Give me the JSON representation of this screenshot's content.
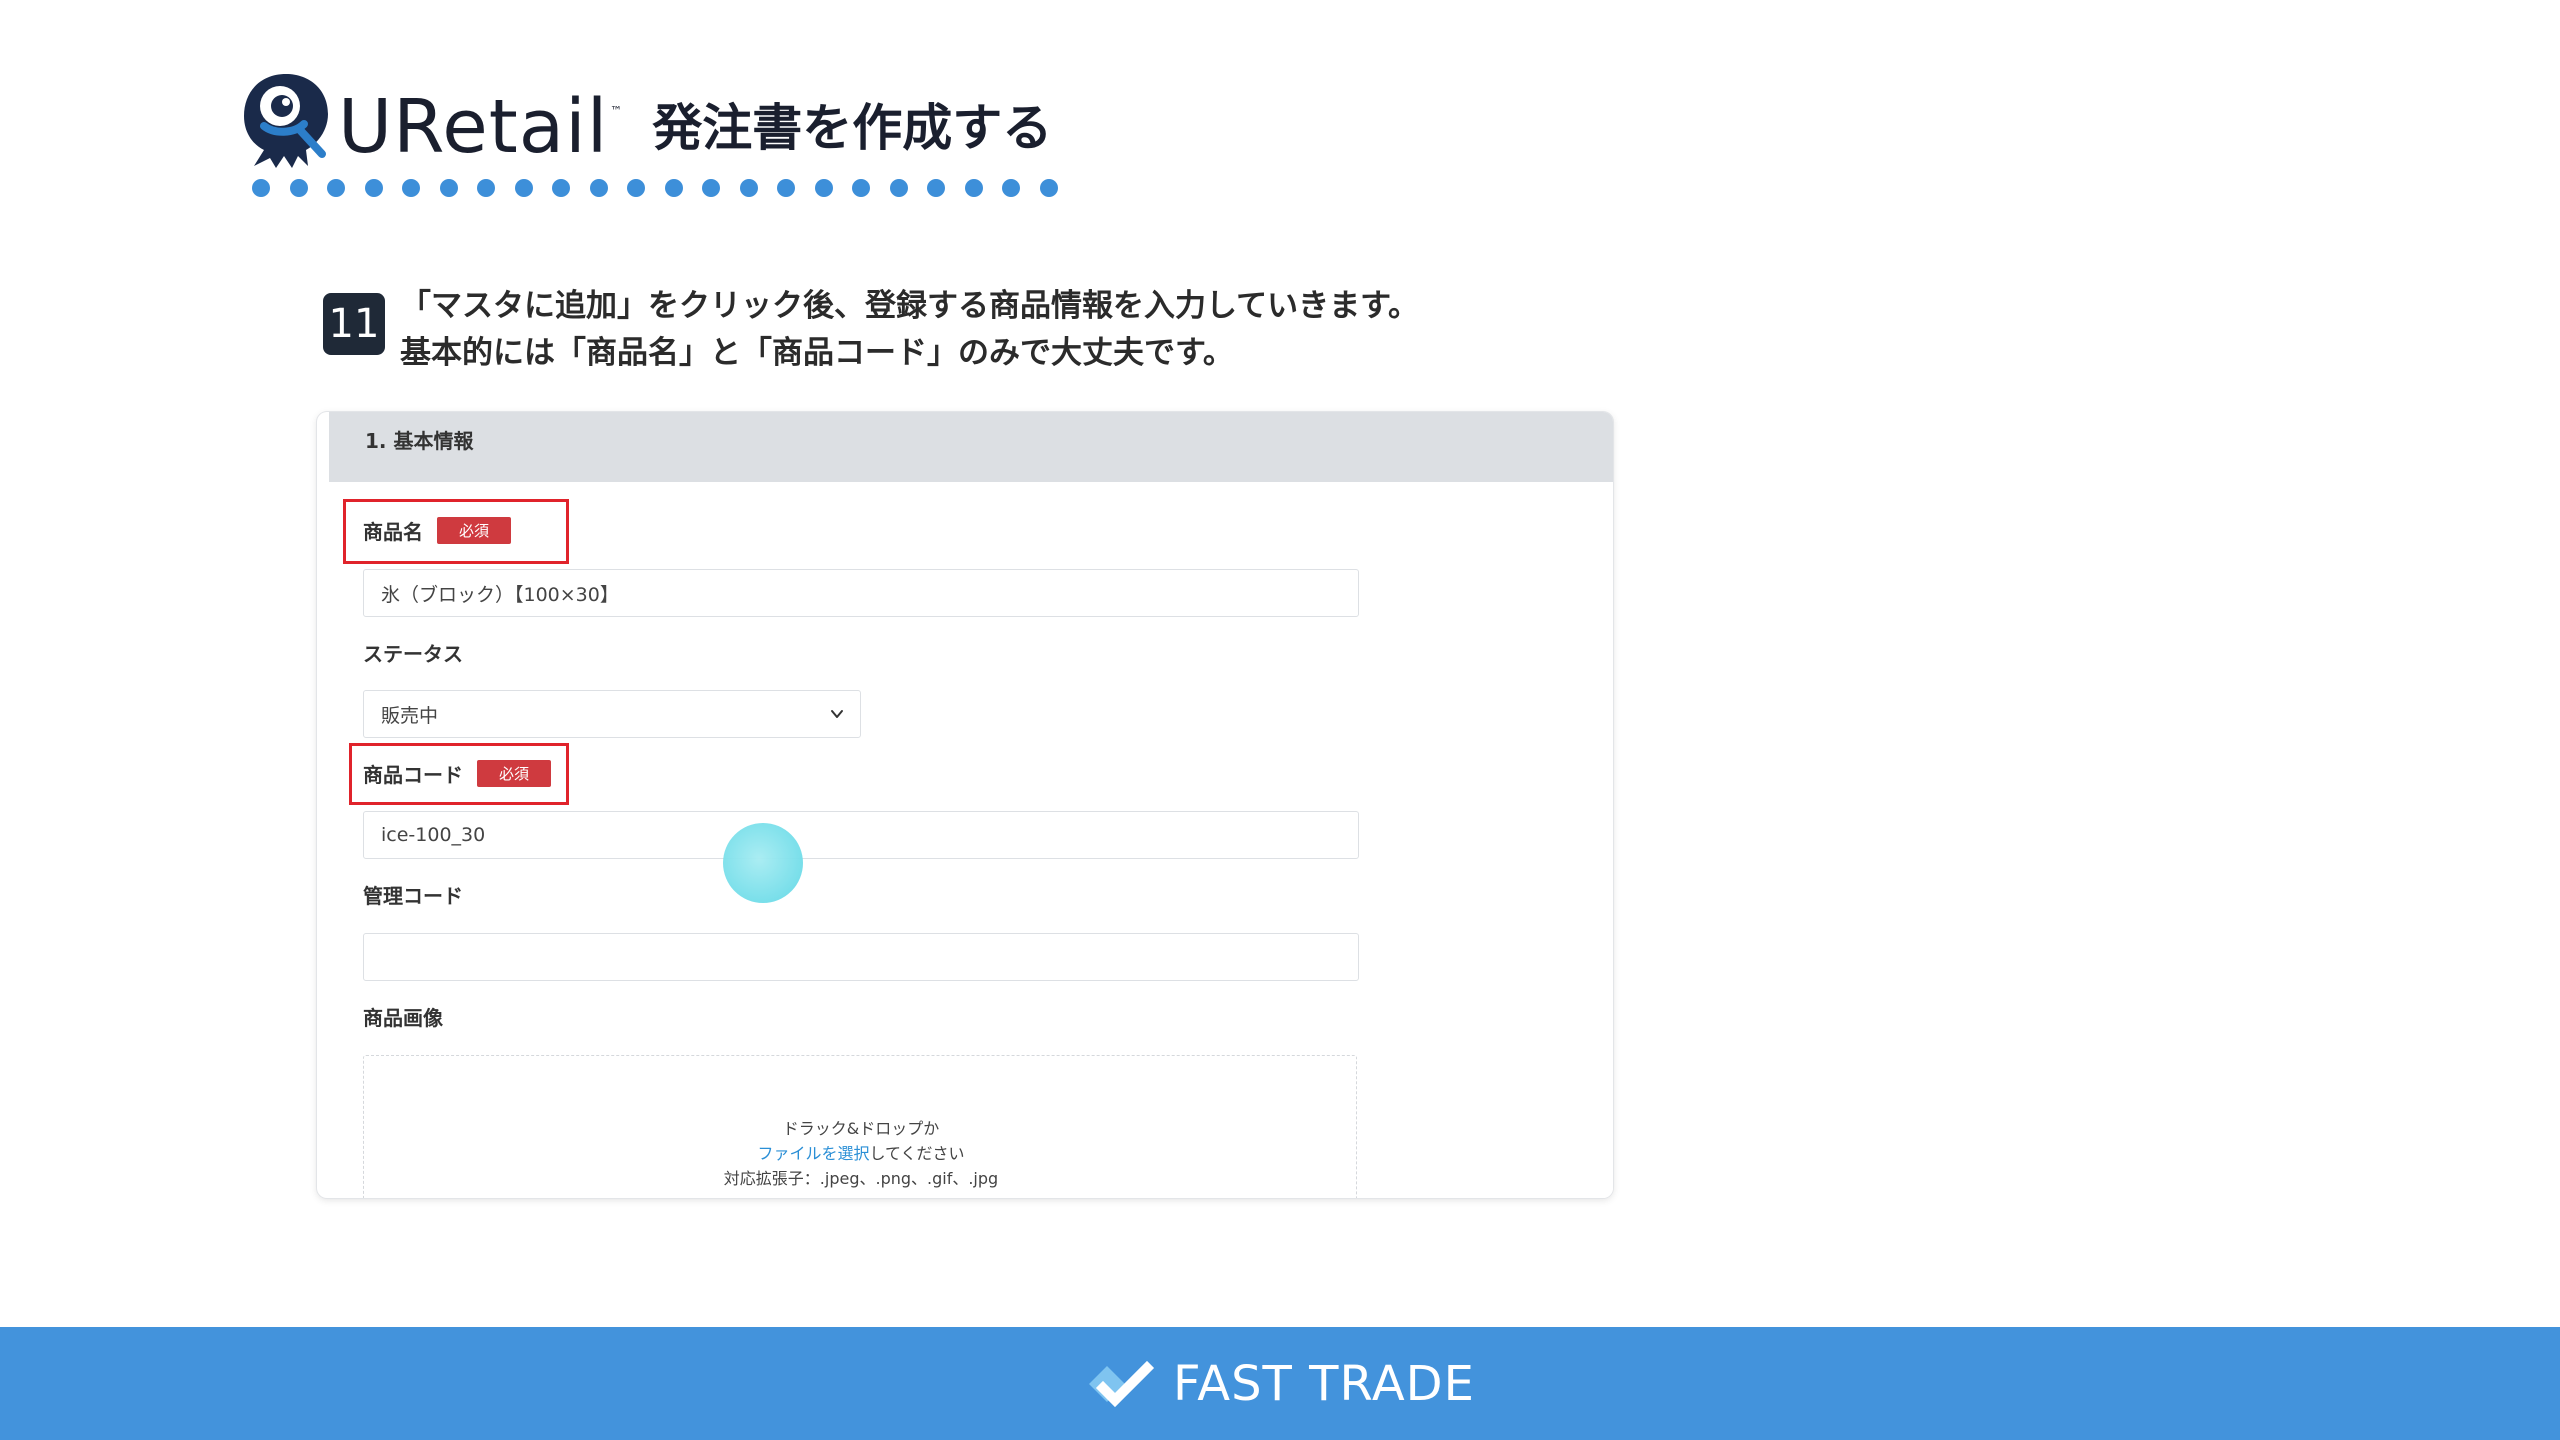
{
  "header": {
    "logo_text": "URetail",
    "logo_tm": "™",
    "title": "発注書を作成する"
  },
  "step": {
    "number": "11",
    "line1": "「マスタに追加」をクリック後、登録する商品情報を入力していきます。",
    "line2": "基本的には「商品名」と「商品コード」のみで大丈夫です。"
  },
  "form": {
    "section_title": "1. 基本情報",
    "product_name_label": "商品名",
    "required_badge": "必須",
    "product_name_value": "氷（ブロック）【100×30】",
    "status_label": "ステータス",
    "status_value": "販売中",
    "product_code_label": "商品コード",
    "product_code_value": "ice-100_30",
    "management_code_label": "管理コード",
    "management_code_value": "",
    "image_label": "商品画像",
    "dropzone": {
      "line1": "ドラック&ドロップか",
      "link": "ファイルを選択",
      "line2_suffix": "してください",
      "line3": "対応拡張子：.jpeg、.png、.gif、.jpg"
    }
  },
  "footer": {
    "brand": "FAST TRADE"
  },
  "colors": {
    "accent_blue": "#4393dc",
    "dot_blue": "#3d8fd9",
    "required_red": "#cf3a3f",
    "highlight_red": "#e0232b",
    "badge_dark": "#1f2937"
  }
}
